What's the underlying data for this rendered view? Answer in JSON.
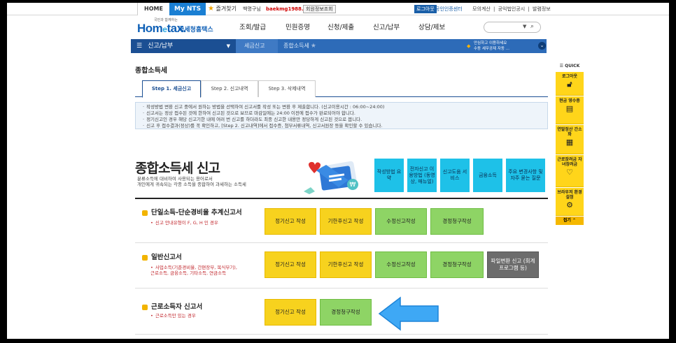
{
  "topbar": {
    "home": "HOME",
    "mynts": "My NTS",
    "favorites": "즐겨찾기",
    "user_name": "백명구님",
    "user_id": "baekmg1988...",
    "member_info": "회원정보조회",
    "logout": "로그아웃",
    "cert_center": "공인인증센터",
    "links": "모의계산 | 공익법인공시 | 발렴정보"
  },
  "header": {
    "logo_tagline": "국민과 함께하는",
    "logo_text_home": "Hom",
    "logo_text_e": "e",
    "logo_text_tax": "tax.",
    "logo_kr": "국세청홈택스",
    "menu": [
      "조회/발급",
      "민원증명",
      "신청/제출",
      "신고/납부",
      "상담/제보"
    ],
    "search_placeholder": ""
  },
  "navstrip": {
    "menu": "신고/납부",
    "crumb1": "세금신고",
    "crumb2": "종합소득세",
    "notice_line1": "안심하고 이용하세요",
    "notice_line2": "수동 세무공제 자동 ..."
  },
  "page": {
    "title": "종합소득세",
    "tabs": [
      "Step 1. 세금신고",
      "Step 2. 신고내역",
      "Step 3. 삭제내역"
    ],
    "info": [
      "작성방법 변환 신고 중에서 원하는 방법을 선택하여 신고서를 작성 또는 변환 후 제출합니다. (신고이용시간 : 06:00~24:00)",
      "신고서는 정상 접수된 것에 한하여 신고된 것으로 보므로 마감일에는 24:00 이전에 접수가 완료되어야 합니다.",
      "정기신고인 경우 해당 신고기한 내에 여러 번 신고를 하더라도 최종 신고한 내용만 정당하게 신고된 것으로 봅니다.",
      "신고 후 접수결과(정상)를 꼭 확인하고, [Step 2. 신고내역]에서 접수증, 첨부서류내역, 신고서원장 등을 확인할 수 있습니다."
    ],
    "main_heading": "종합소득세 신고",
    "main_desc_1": "분류소득에 대비하여 사용되는 용어로서",
    "main_desc_2": "개인에게 귀속되는 각종 소득을 종합하여 과세하는 소득세",
    "quick_buttons": [
      "작성방법 요약",
      "전자신고 이용방법 (동영상, 매뉴얼)",
      "신고도움 서비스",
      "금융소득",
      "주요 변경사항 및 자주 묻는 질문"
    ]
  },
  "sections": [
    {
      "title": "단일소득-단순경비율 추계신고서",
      "sub": [
        "신고 안내유형이 F, G, H 인 경우"
      ],
      "buttons": [
        "정기신고 작성",
        "기한후신고 작성",
        "수정신고작성",
        "경정청구작성"
      ]
    },
    {
      "title": "일반신고서",
      "sub": [
        "사업소득(기준경비율, 간편장부, 복식부기),",
        "근로소득, 금융소득, 기타소득, 연금소득"
      ],
      "buttons": [
        "정기신고 작성",
        "기한후신고 작성",
        "수정신고작성",
        "경정청구작성",
        "파일변환 신고 (회계 프로그램 등)"
      ]
    },
    {
      "title": "근로소득자 신고서",
      "sub": [
        "근로소득만 있는 경우"
      ],
      "buttons": [
        "정기신고 작성",
        "경정청구작성"
      ]
    }
  ],
  "quick": {
    "header": "QUICK",
    "items": [
      "로그아웃",
      "현금 영수증",
      "연말정산 간소화",
      "근로장려금 자녀장려금",
      "브라우저 환경설정"
    ],
    "close": "접기"
  }
}
